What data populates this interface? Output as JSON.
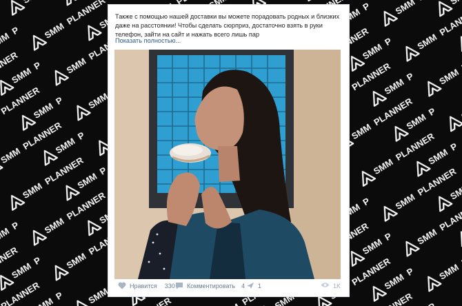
{
  "background": {
    "watermark_text": "SMM PLANNER",
    "color": "#0b0b0b"
  },
  "post": {
    "text": "Также с помощью нашей доставки вы можете порадовать родных и близких даже на расстоянии! Чтобы сделать сюрприз, достаточно взять в руки телефон, зайти на сайт и нажать всего лишь пар",
    "show_more": "Показать полностью...",
    "image_description": "Woman eating a pastry in front of a blue glass-block window"
  },
  "actions": {
    "like_label": "Нравится",
    "like_count": "330",
    "comment_label": "Комментировать",
    "comment_count": "4",
    "share_count": "1",
    "views": "1K"
  },
  "colors": {
    "link": "#2a5885",
    "action_text": "#6b7d92",
    "accent_blue": "#2b97c7"
  }
}
